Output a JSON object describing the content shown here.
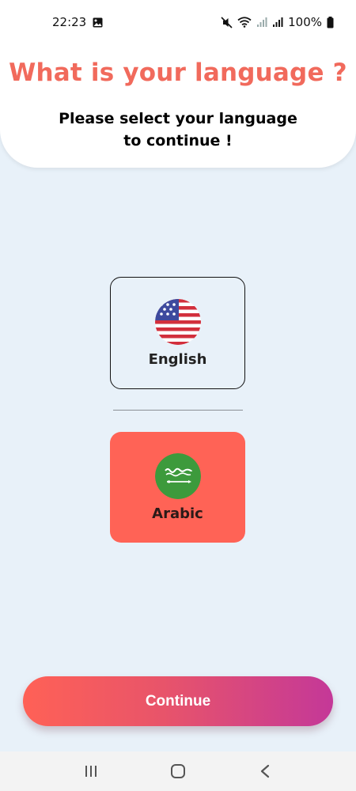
{
  "status_bar": {
    "time": "22:23",
    "battery": "100%",
    "icons": [
      "gallery-icon",
      "mute-icon",
      "wifi-icon",
      "signal-icon",
      "signal-icon",
      "battery-icon"
    ]
  },
  "header": {
    "title": "What is your language ?",
    "subtitle": "Please select your language to continue !"
  },
  "languages": [
    {
      "label": "English",
      "flag": "us-flag-icon"
    },
    {
      "label": "Arabic",
      "flag": "saudi-flag-icon"
    }
  ],
  "actions": {
    "continue_label": "Continue"
  },
  "nav_bar": {
    "items": [
      "recent-apps-icon",
      "home-icon",
      "back-icon"
    ]
  },
  "colors": {
    "accent": "#f16a5c",
    "selected_card": "#ff6356",
    "background": "#e8f1f9",
    "button_gradient_start": "#ff6156",
    "button_gradient_end": "#c43898"
  }
}
